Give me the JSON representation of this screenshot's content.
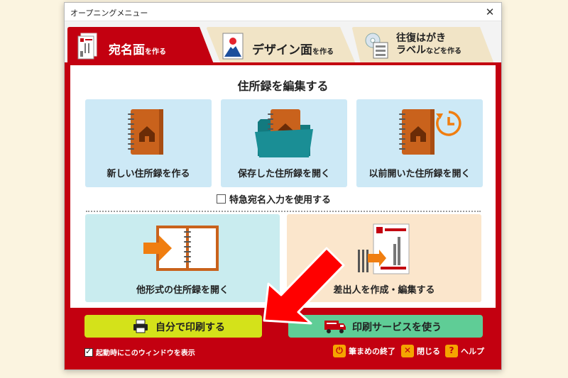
{
  "window": {
    "title": "オープニングメニュー",
    "close_glyph": "✕"
  },
  "tabs": {
    "active": {
      "main": "宛名面",
      "sub": "を作る"
    },
    "design": {
      "main": "デザイン面",
      "sub": "を作る"
    },
    "label": {
      "line1": "往復はがき",
      "line2_main": "ラベル",
      "line2_sub": "などを作る"
    }
  },
  "main": {
    "section_title": "住所録を編集する",
    "cards": {
      "new": "新しい住所録を作る",
      "open_saved": "保存した住所録を開く",
      "open_recent": "以前開いた住所録を開く",
      "open_other": "他形式の住所録を開く",
      "sender": "差出人を作成・編集する"
    },
    "express_checkbox": "特急宛名入力を使用する"
  },
  "buttons": {
    "print_self": "自分で印刷する",
    "print_service": "印刷サービスを使う"
  },
  "footer": {
    "startup_check": "起動時にこのウィンドウを表示",
    "quit": "筆まめの終了",
    "close": "閉じる",
    "help": "ヘルプ"
  },
  "colors": {
    "brand_red": "#c30010",
    "tab_inactive": "#f1e4c6",
    "print_button": "#d4e21a",
    "service_button": "#5fcd96",
    "book_orange": "#c9621c",
    "pointer_arrow": "#ff0000"
  },
  "icons": [
    "close-icon",
    "postcard-icon",
    "fuji-postcard-icon",
    "cd-label-icon",
    "address-book-icon",
    "folder-icon",
    "clock-icon",
    "open-book-icon",
    "sender-postcard-icon",
    "printer-icon",
    "truck-icon",
    "quit-icon",
    "close-x-icon",
    "help-icon",
    "pointer-arrow-icon"
  ]
}
